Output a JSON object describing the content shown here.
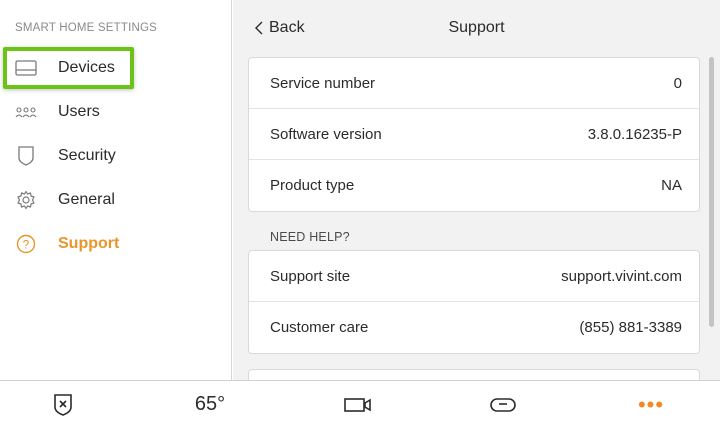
{
  "sidebar": {
    "title": "SMART HOME SETTINGS",
    "items": [
      {
        "label": "Devices",
        "icon": "devices-icon"
      },
      {
        "label": "Users",
        "icon": "users-icon"
      },
      {
        "label": "Security",
        "icon": "shield-icon"
      },
      {
        "label": "General",
        "icon": "gear-icon"
      },
      {
        "label": "Support",
        "icon": "help-circle-icon",
        "active": true
      }
    ]
  },
  "header": {
    "back_label": "Back",
    "title": "Support"
  },
  "info": [
    {
      "key": "Service number",
      "value": "0"
    },
    {
      "key": "Software version",
      "value": "3.8.0.16235-P"
    },
    {
      "key": "Product type",
      "value": "NA"
    }
  ],
  "help": {
    "section_label": "NEED HELP?",
    "rows": [
      {
        "key": "Support site",
        "value": "support.vivint.com"
      },
      {
        "key": "Customer care",
        "value": "(855) 881-3389"
      }
    ]
  },
  "bottombar": {
    "temperature": "65°",
    "more": "•••"
  },
  "colors": {
    "accent": "#e8962a",
    "highlight": "#6cc317",
    "main_bg": "#f2f2f2"
  }
}
